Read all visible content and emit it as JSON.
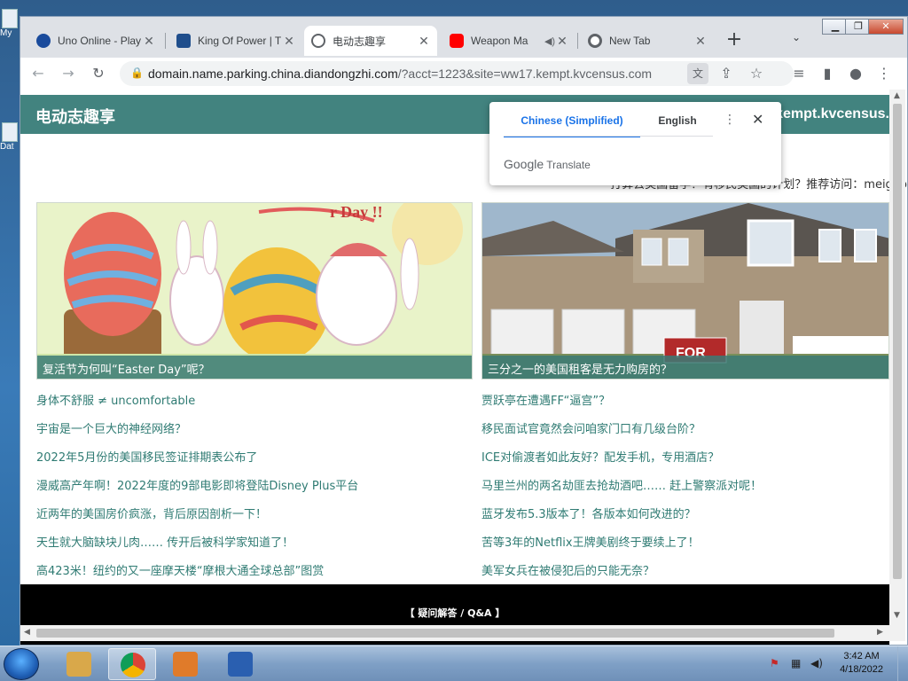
{
  "desktop": {
    "icons": [
      {
        "label": "My",
        "name": "computer-icon"
      },
      {
        "label": "Dat",
        "name": "data-icon"
      }
    ]
  },
  "window": {
    "controls": {
      "minimize": "▁",
      "restore": "❐",
      "close": "✕"
    }
  },
  "tabs": [
    {
      "title": "Uno Online - Play",
      "favicon_color": "#1a4b9c",
      "active": false
    },
    {
      "title": "King Of Power | T",
      "favicon_color": "#1f4e8c",
      "active": false
    },
    {
      "title": "电动志趣享",
      "favicon_color": "#5f6368",
      "active": true
    },
    {
      "title": "Weapon Ma",
      "favicon_color": "#ff0000",
      "active": false,
      "audio": true
    },
    {
      "title": "New Tab",
      "favicon_color": "#5f6368",
      "active": false
    }
  ],
  "tabs_close_symbol": "✕",
  "new_tab_symbol": "+",
  "tab_search_symbol": "⌄",
  "toolbar": {
    "url_host": "domain.name.parking.china.diandongzhi.com",
    "url_rest": "/?acct=1223&site=ww17.kempt.kvcensus.com"
  },
  "page": {
    "site_title": "电动志趣享",
    "banner_right": "kempt.kvcensus.",
    "promo": "打算去美国留学？有移民美国的计划？推荐访问：meiguo",
    "cards": [
      {
        "caption": "复活节为何叫“Easter Day”呢？"
      },
      {
        "caption": "三分之一的美国租客是无力购房的？"
      }
    ],
    "links_left": [
      "身体不舒服 ≠ uncomfortable",
      "宇宙是一个巨大的神经网络？",
      "2022年5月份的美国移民签证排期表公布了",
      "漫威高产年啊！2022年度的9部电影即将登陆Disney Plus平台",
      "近两年的美国房价疯涨，背后原因剖析一下！",
      "天生就大脑缺块儿肉…… 传开后被科学家知道了！",
      "高423米！纽约的又一座摩天楼“摩根大通全球总部”图赏"
    ],
    "links_right": [
      "贾跃亭在遭遇FF“逼宫”？",
      "移民面试官竟然会问咱家门口有几级台阶？",
      "ICE对偷渡者如此友好？配发手机，专用酒店？",
      "马里兰州的两名劫匪去抢劫酒吧…… 赶上警察派对呢！",
      "蓝牙发布5.3版本了！各版本如何改进的？",
      "苦等3年的Netflix王牌美剧终于要续上了！",
      "美军女兵在被侵犯后的只能无奈？"
    ],
    "footer": "【 疑问解答 / Q&A 】",
    "egg_sign": "r Day !!",
    "house_sign": "FOR"
  },
  "translate_popup": {
    "tab_source": "Chinese (Simplified)",
    "tab_target": "English",
    "brand_google": "Google",
    "brand_translate": "Translate",
    "more_symbol": "⋮",
    "close_symbol": "✕"
  },
  "taskbar": {
    "apps": [
      {
        "name": "file-explorer-icon",
        "color": "#d9a84a"
      },
      {
        "name": "chrome-icon",
        "color": "#1a73e8",
        "active": true
      },
      {
        "name": "media-player-icon",
        "color": "#e07b2a"
      },
      {
        "name": "powershell-icon",
        "color": "#2a5fb0"
      }
    ],
    "time": "3:42 AM",
    "date": "4/18/2022"
  }
}
